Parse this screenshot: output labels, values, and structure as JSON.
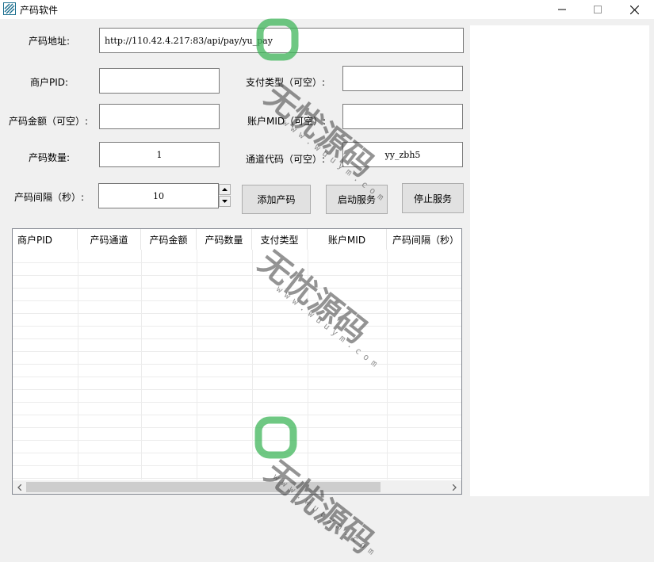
{
  "window": {
    "title": "产码软件",
    "minimize_glyph": "—",
    "maximize_glyph": "☐",
    "close_glyph": "✕"
  },
  "form": {
    "url_label": "产码地址:",
    "url_value": "http://110.42.4.217:83/api/pay/yu_pay",
    "pid_label": "商户PID:",
    "pid_value": "",
    "pay_type_label": "支付类型（可空）:",
    "pay_type_value": "",
    "amount_label": "产码金额（可空）:",
    "amount_value": "",
    "mid_label": "账户MID（可空）:",
    "mid_value": "",
    "count_label": "产码数量:",
    "count_value": "1",
    "channel_label": "通道代码（可空）:",
    "channel_value": "yy_zbh5",
    "interval_label": "产码间隔（秒）:",
    "interval_value": "10"
  },
  "buttons": {
    "add": "添加产码",
    "start": "启动服务",
    "stop": "停止服务"
  },
  "table": {
    "columns": [
      "商户PID",
      "产码通道",
      "产码金额",
      "产码数量",
      "支付类型",
      "账户MID",
      "产码间隔（秒）"
    ]
  },
  "watermark": {
    "brand": "无忧源码",
    "url": "www.wuuym.com"
  },
  "colors": {
    "accent_green": "#3fb55a",
    "window_bg": "#f0f0f0"
  }
}
